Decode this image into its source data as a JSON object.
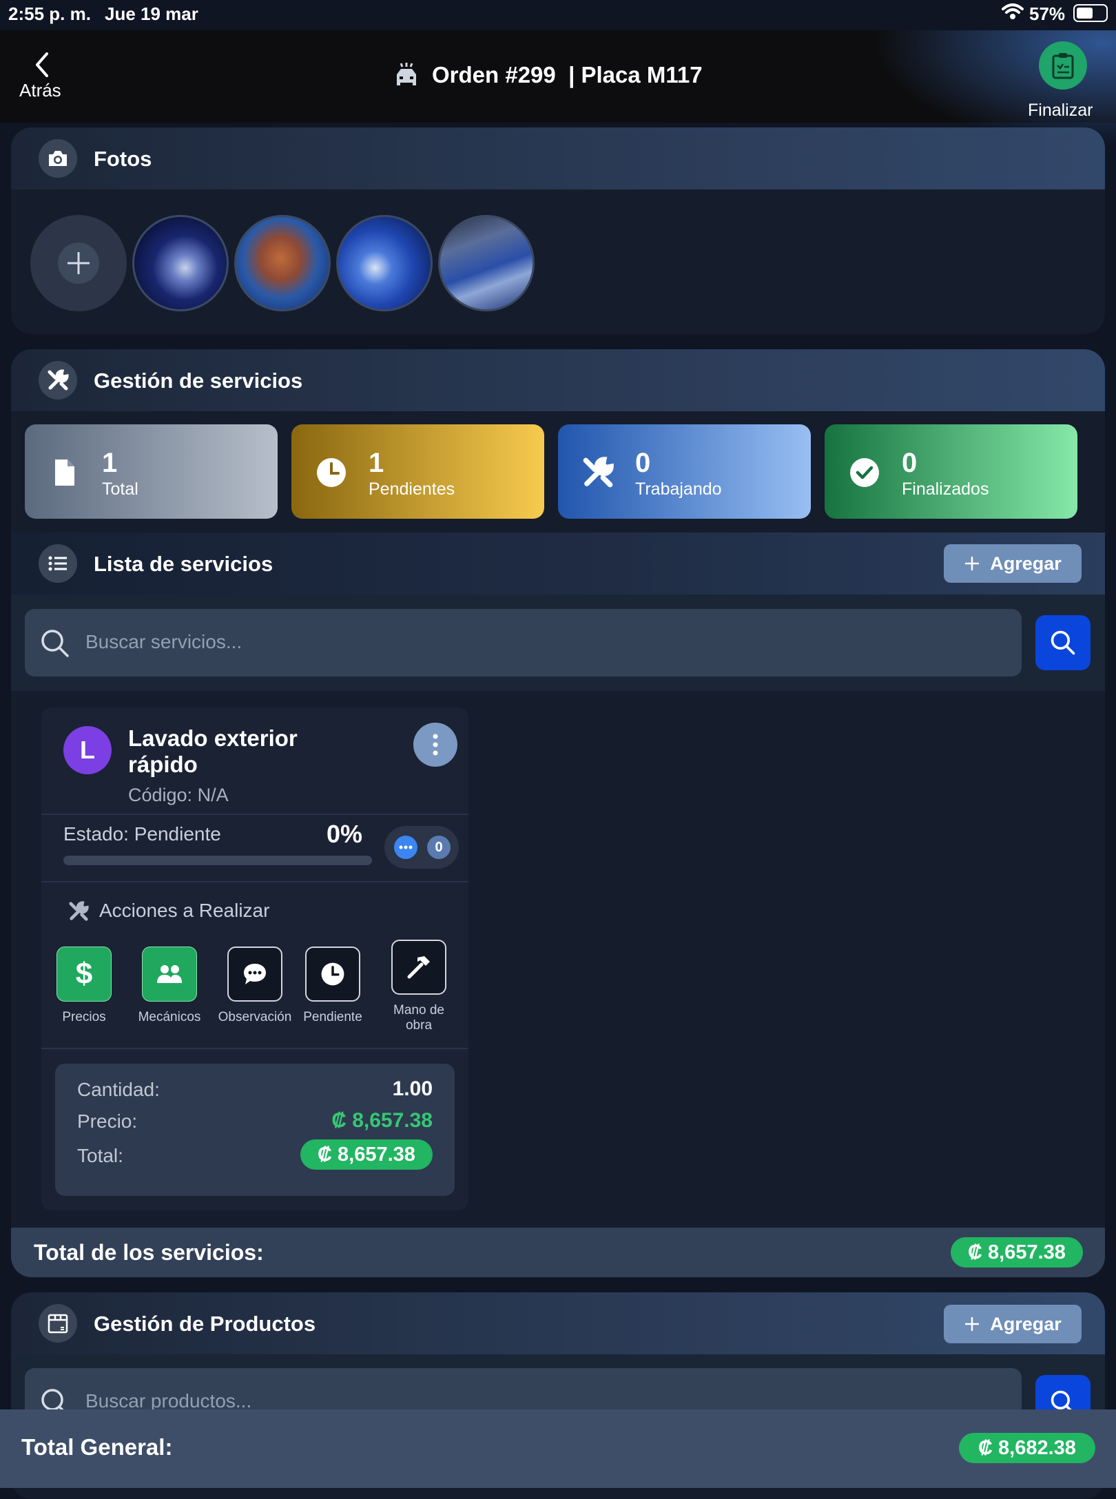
{
  "status_bar": {
    "time": "2:55 p. m.",
    "date": "Jue 19 mar",
    "battery": "57%",
    "battery_level": 0.57
  },
  "nav": {
    "back_label": "Atrás",
    "title": "Orden #299  | Placa M117",
    "finish_label": "Finalizar"
  },
  "photos": {
    "title": "Fotos",
    "count": 4
  },
  "services_mgmt": {
    "title": "Gestión de servicios",
    "stats": [
      {
        "value": "1",
        "label": "Total"
      },
      {
        "value": "1",
        "label": "Pendientes"
      },
      {
        "value": "0",
        "label": "Trabajando"
      },
      {
        "value": "0",
        "label": "Finalizados"
      }
    ]
  },
  "service_list": {
    "title": "Lista de servicios",
    "add_label": "Agregar",
    "search_placeholder": "Buscar servicios...",
    "items": [
      {
        "avatar_letter": "L",
        "name_line1": "Lavado exterior",
        "name_line2": "rápido",
        "code": "Código: N/A",
        "status": "Estado: Pendiente",
        "progress_label": "0%",
        "progress": 0,
        "comments_count": "0",
        "actions_title": "Acciones a Realizar",
        "actions": [
          {
            "label": "Precios",
            "icon": "dollar-icon"
          },
          {
            "label": "Mecánicos",
            "icon": "users-icon"
          },
          {
            "label": "Observación",
            "icon": "comment-icon"
          },
          {
            "label": "Pendiente",
            "icon": "clock-icon"
          },
          {
            "label_line1": "Mano de",
            "label_line2": "obra",
            "icon": "hammer-icon"
          }
        ],
        "qty_label": "Cantidad:",
        "qty_value": "1.00",
        "price_label": "Precio:",
        "price_value": "₡ 8,657.38",
        "total_label": "Total:",
        "total_value": "₡ 8,657.38"
      }
    ],
    "services_total_label": "Total de los servicios:",
    "services_total_value": "₡ 8,657.38"
  },
  "products": {
    "title": "Gestión de Productos",
    "add_label": "Agregar",
    "search_placeholder": "Buscar productos..."
  },
  "footer": {
    "label": "Total General:",
    "value": "₡ 8,682.38"
  },
  "colors": {
    "background": "#0f1523",
    "accent_blue": "#0a46dc",
    "green": "#22b562",
    "pending_gold": "#e9b93c",
    "working_blue": "#4d86d6",
    "done_green": "#2ea866",
    "avatar_purple": "#7b3fe4"
  }
}
